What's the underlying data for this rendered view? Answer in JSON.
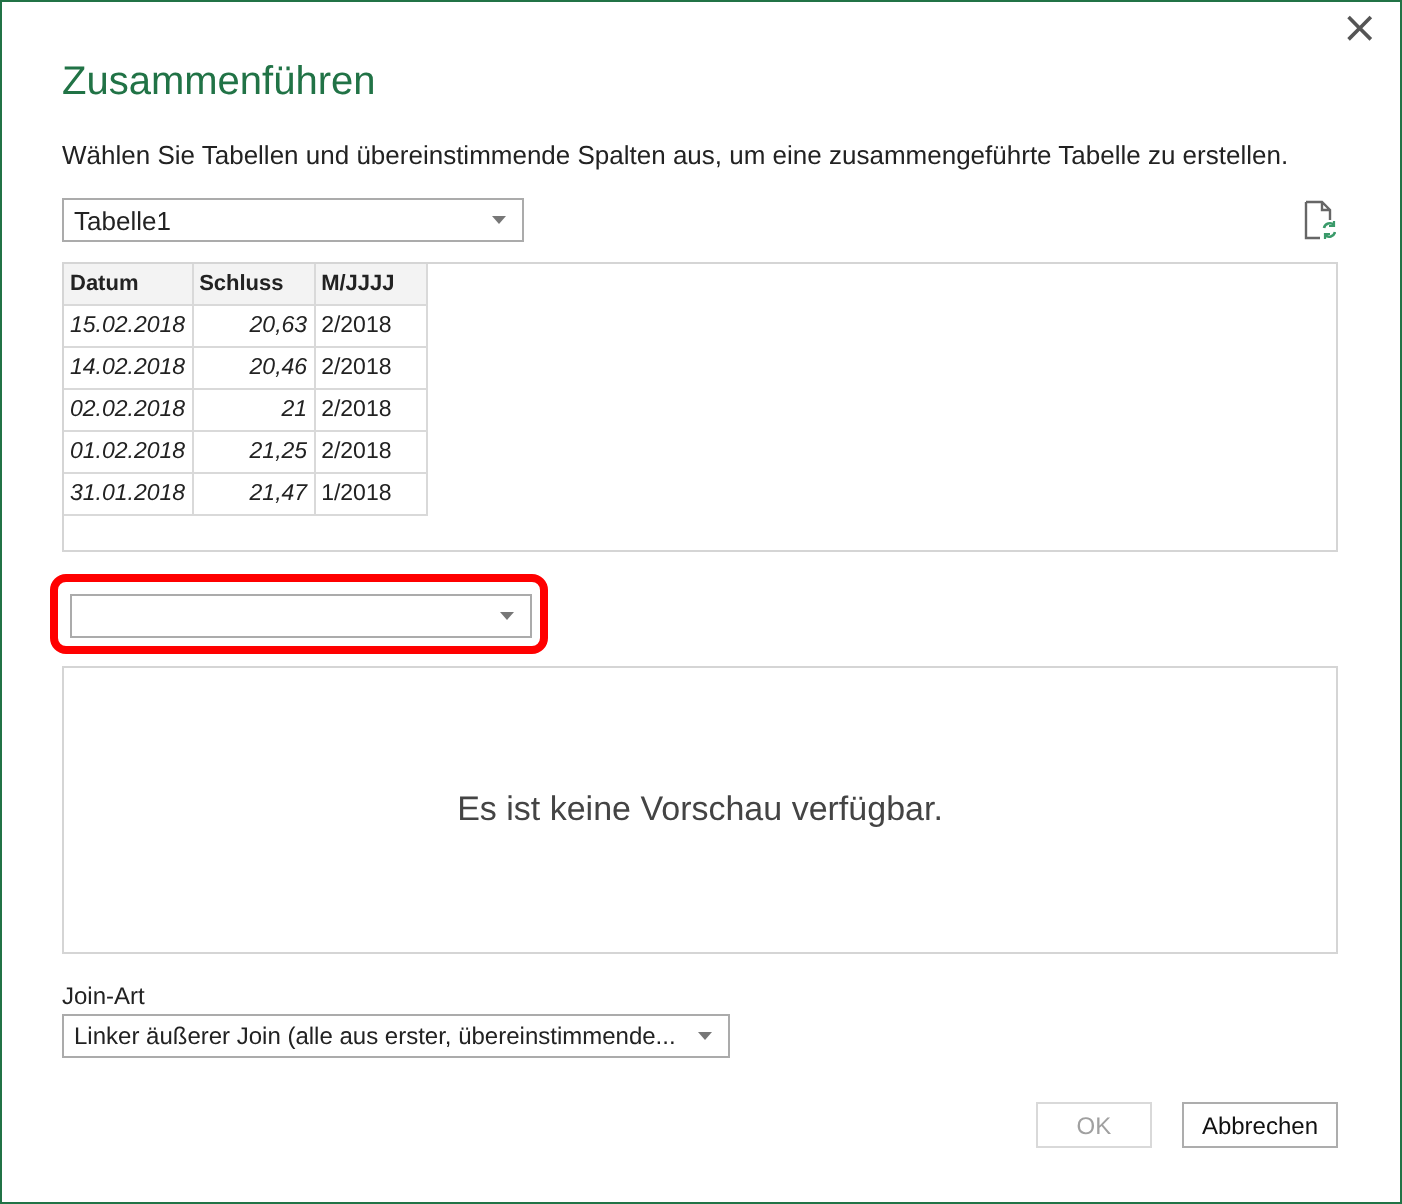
{
  "window": {
    "title": "Zusammenführen",
    "close": "×"
  },
  "description": "Wählen Sie Tabellen und übereinstimmende Spalten aus, um eine zusammengeführte Tabelle zu erstellen.",
  "first_table": {
    "value": "Tabelle1",
    "columns": [
      {
        "label": "Datum",
        "kind": "date"
      },
      {
        "label": "Schluss",
        "kind": "number"
      },
      {
        "label": "M/JJJJ",
        "kind": "text"
      }
    ],
    "rows": [
      [
        "15.02.2018",
        "20,63",
        "2/2018"
      ],
      [
        "14.02.2018",
        "20,46",
        "2/2018"
      ],
      [
        "02.02.2018",
        "21",
        "2/2018"
      ],
      [
        "01.02.2018",
        "21,25",
        "2/2018"
      ],
      [
        "31.01.2018",
        "21,47",
        "1/2018"
      ]
    ]
  },
  "second_table": {
    "highlighted": true,
    "preview_message": "Es ist keine Vorschau verfügbar."
  },
  "join_kind": {
    "label": "Join-Art",
    "value": "Linker äußerer Join (alle aus erster, übereinstimmende..."
  },
  "buttons": [
    {
      "label": "OK",
      "disabled": true
    },
    {
      "label": "Abbrechen",
      "disabled": false
    }
  ]
}
